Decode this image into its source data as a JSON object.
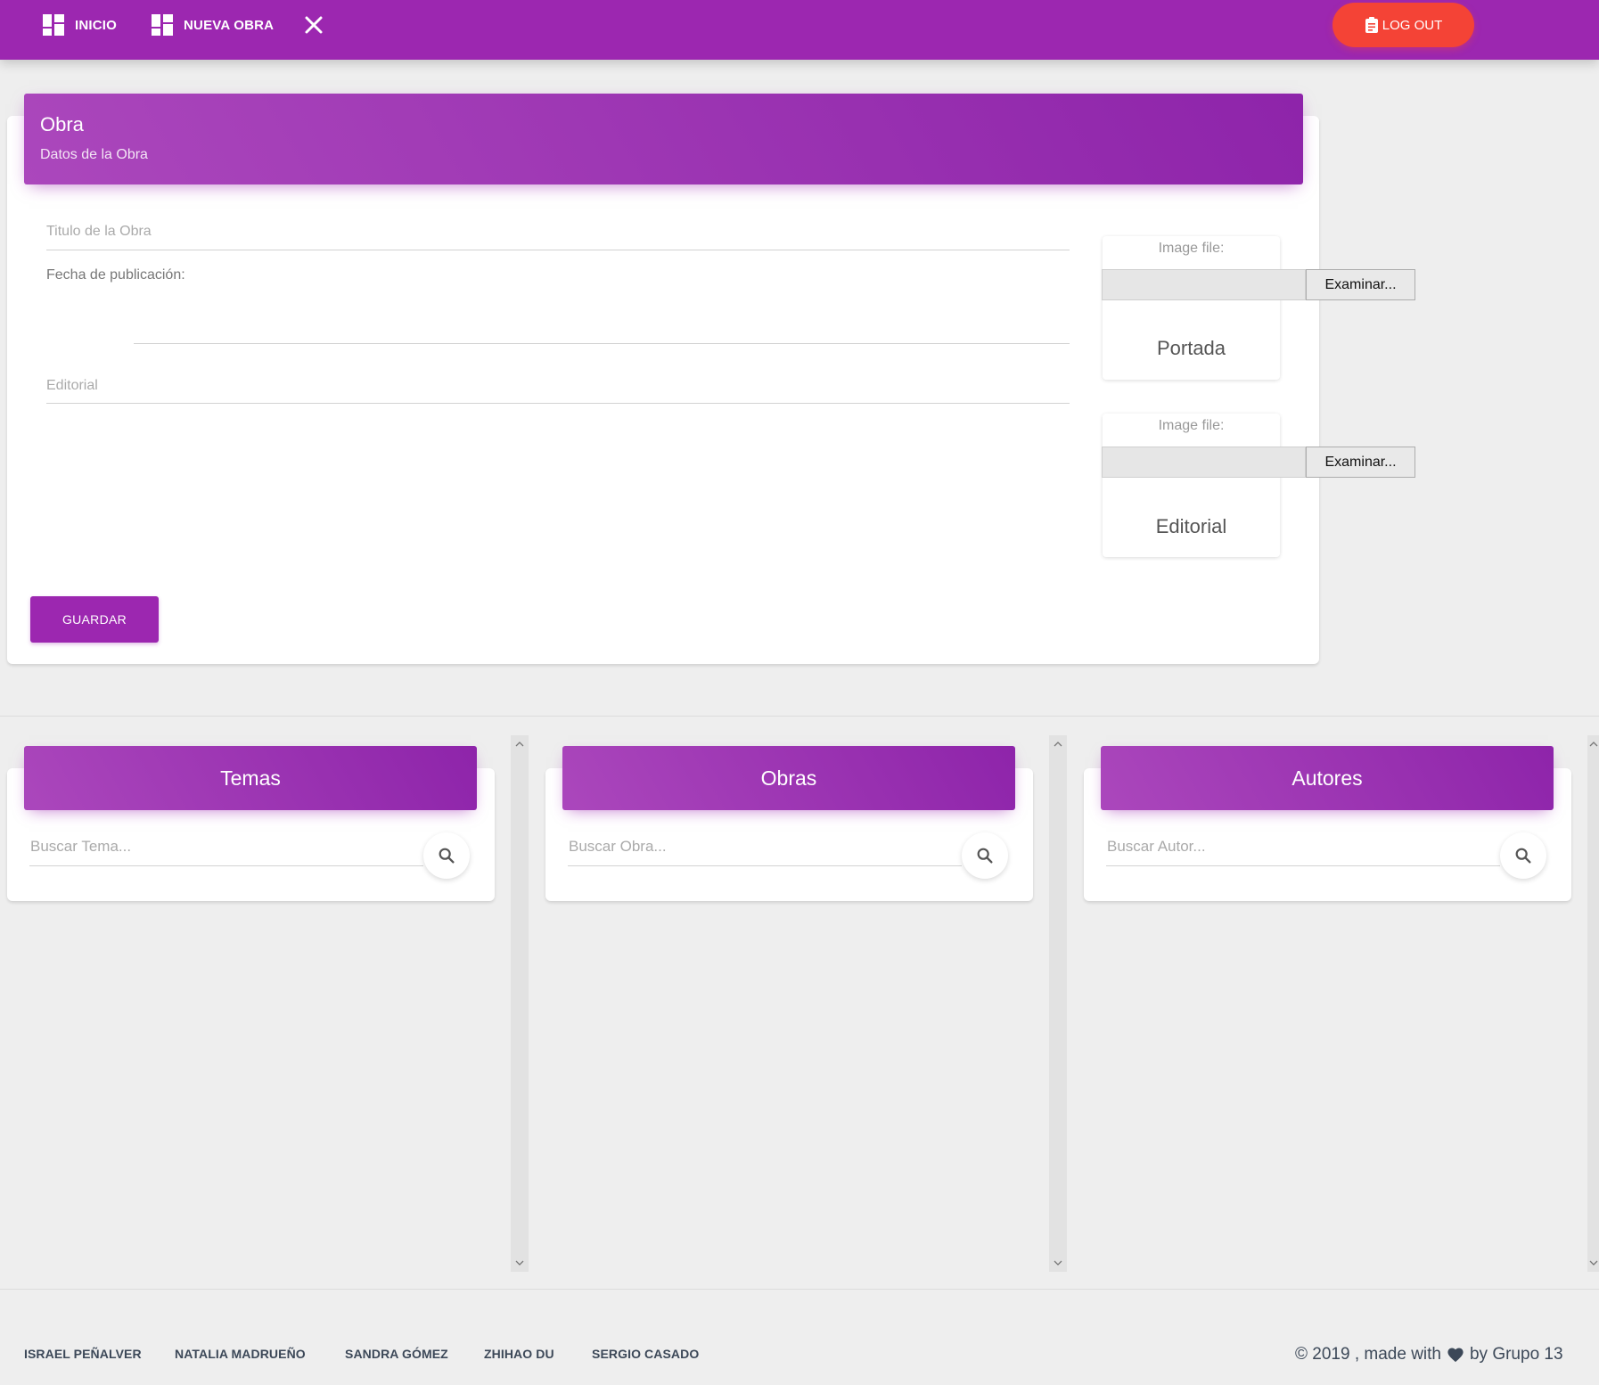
{
  "navbar": {
    "items": [
      {
        "label": "INICIO",
        "icon": "dashboard-icon"
      },
      {
        "label": "NUEVA OBRA",
        "icon": "dashboard-icon"
      }
    ],
    "close_icon": "close-icon",
    "logout_label": "LOG OUT",
    "logout_icon": "clipboard-icon"
  },
  "obra_form": {
    "title": "Obra",
    "subtitle": "Datos de la Obra",
    "fields": {
      "titulo_placeholder": "Titulo de la Obra",
      "fecha_label": "Fecha de publicación:",
      "editorial_placeholder": "Editorial"
    },
    "images": [
      {
        "file_label": "Image file:",
        "button": "Examinar...",
        "caption": "Portada"
      },
      {
        "file_label": "Image file:",
        "button": "Examinar...",
        "caption": "Editorial"
      }
    ],
    "save_label": "GUARDAR"
  },
  "columns": [
    {
      "title": "Temas",
      "placeholder": "Buscar Tema...",
      "icon": "search-icon"
    },
    {
      "title": "Obras",
      "placeholder": "Buscar Obra...",
      "icon": "search-icon"
    },
    {
      "title": "Autores",
      "placeholder": "Buscar Autor...",
      "icon": "search-icon"
    }
  ],
  "footer": {
    "links": [
      "ISRAEL PEÑALVER",
      "NATALIA MADRUEÑO",
      "SANDRA GÓMEZ",
      "ZHIHAO DU",
      "SERGIO CASADO"
    ],
    "copyright_prefix": "© 2019 , made with",
    "copyright_suffix": "by Grupo 13",
    "heart_icon": "heart-icon"
  },
  "colors": {
    "primary": "#9c27b0",
    "danger": "#f44336",
    "background": "#eeeeee"
  }
}
